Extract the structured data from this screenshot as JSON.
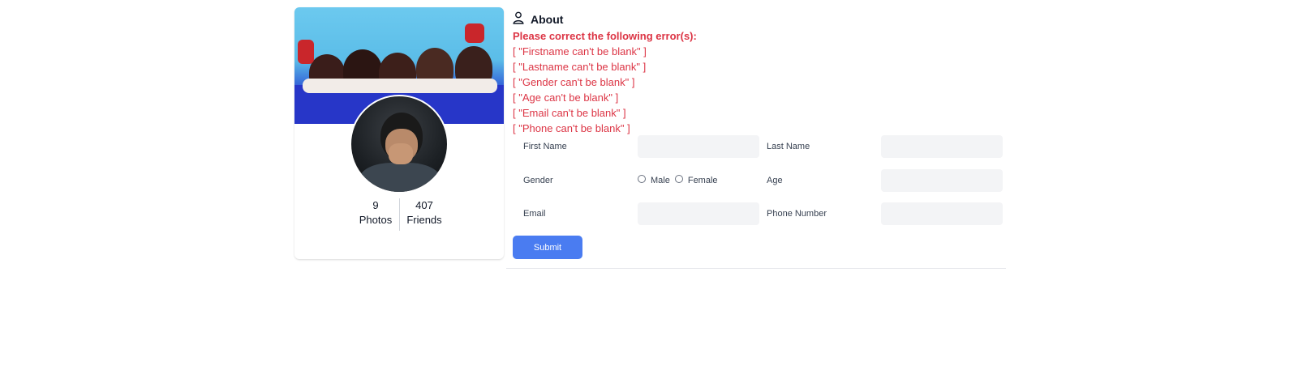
{
  "profile": {
    "cover_image": "group-photo-cover",
    "avatar_image": "user-avatar-photo",
    "stats": [
      {
        "value": "9",
        "label": "Photos"
      },
      {
        "value": "407",
        "label": "Friends"
      }
    ]
  },
  "about": {
    "icon": "user-icon",
    "title": "About",
    "errors": {
      "heading": "Please correct the following error(s):",
      "items": [
        "[ \"Firstname can't be blank\" ]",
        "[ \"Lastname can't be blank\" ]",
        "[ \"Gender can't be blank\" ]",
        "[ \"Age can't be blank\" ]",
        "[ \"Email can't be blank\" ]",
        "[ \"Phone can't be blank\" ]"
      ]
    },
    "form": {
      "first_name_label": "First Name",
      "first_name_value": "",
      "last_name_label": "Last Name",
      "last_name_value": "",
      "gender_label": "Gender",
      "gender_options": [
        "Male",
        "Female"
      ],
      "age_label": "Age",
      "age_value": "",
      "email_label": "Email",
      "email_value": "",
      "phone_label": "Phone Number",
      "phone_value": "",
      "submit_label": "Submit"
    }
  },
  "colors": {
    "error": "#dc3545",
    "accent": "#4a7cf1",
    "input_bg": "#f3f4f6"
  }
}
